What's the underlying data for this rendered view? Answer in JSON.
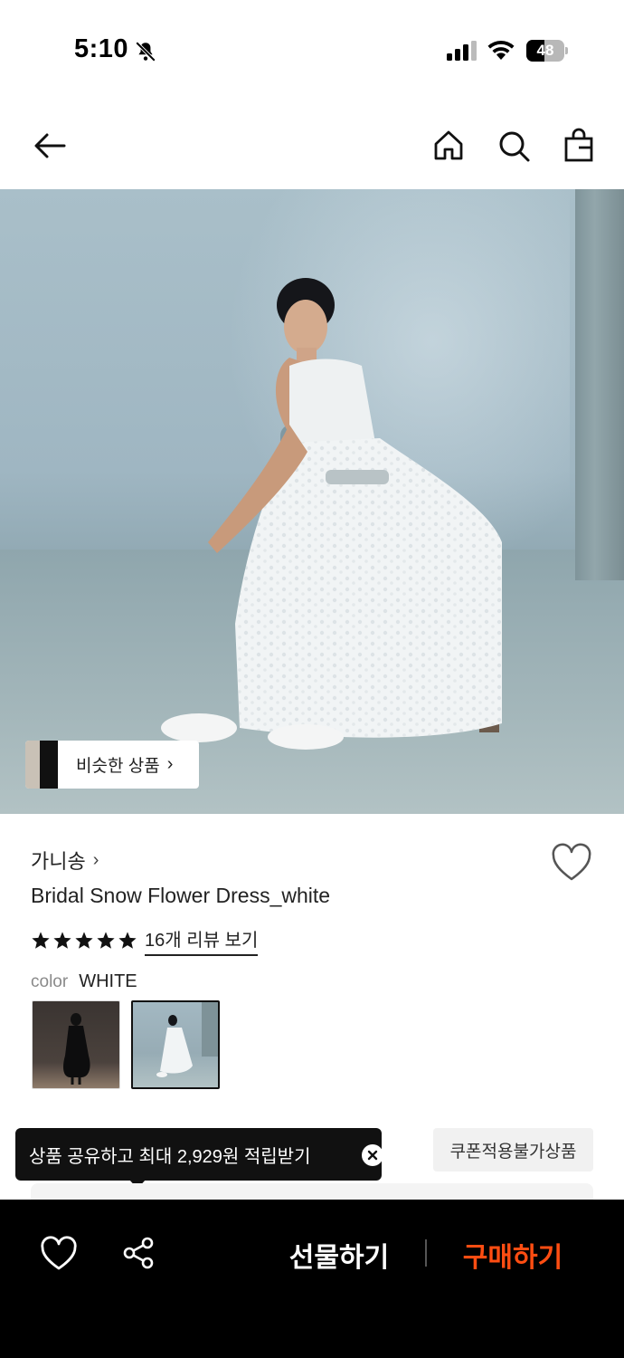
{
  "status_bar": {
    "time": "5:10",
    "battery": "48",
    "battery_level": 0.48
  },
  "nav": {
    "icons": [
      "back-arrow-icon",
      "home-icon",
      "search-icon",
      "shopping-bag-icon"
    ]
  },
  "hero": {
    "similar_label": "비슷한 상품",
    "similar_chevron": "›"
  },
  "product": {
    "brand": "가니송",
    "brand_chevron": "›",
    "title": "Bridal Snow Flower Dress_white",
    "rating_stars": 5,
    "review_link": "16개 리뷰 보기",
    "color_label": "color",
    "color_value": "WHITE",
    "swatches": [
      "black",
      "white"
    ],
    "selected_swatch": 1
  },
  "share_tooltip": {
    "text": "상품 공유하고 최대 2,929원 적립받기"
  },
  "coupon_badge": "쿠폰적용불가상품",
  "bottom_bar": {
    "gift_label": "선물하기",
    "buy_label": "구매하기",
    "buy_color": "#ff4d12"
  }
}
